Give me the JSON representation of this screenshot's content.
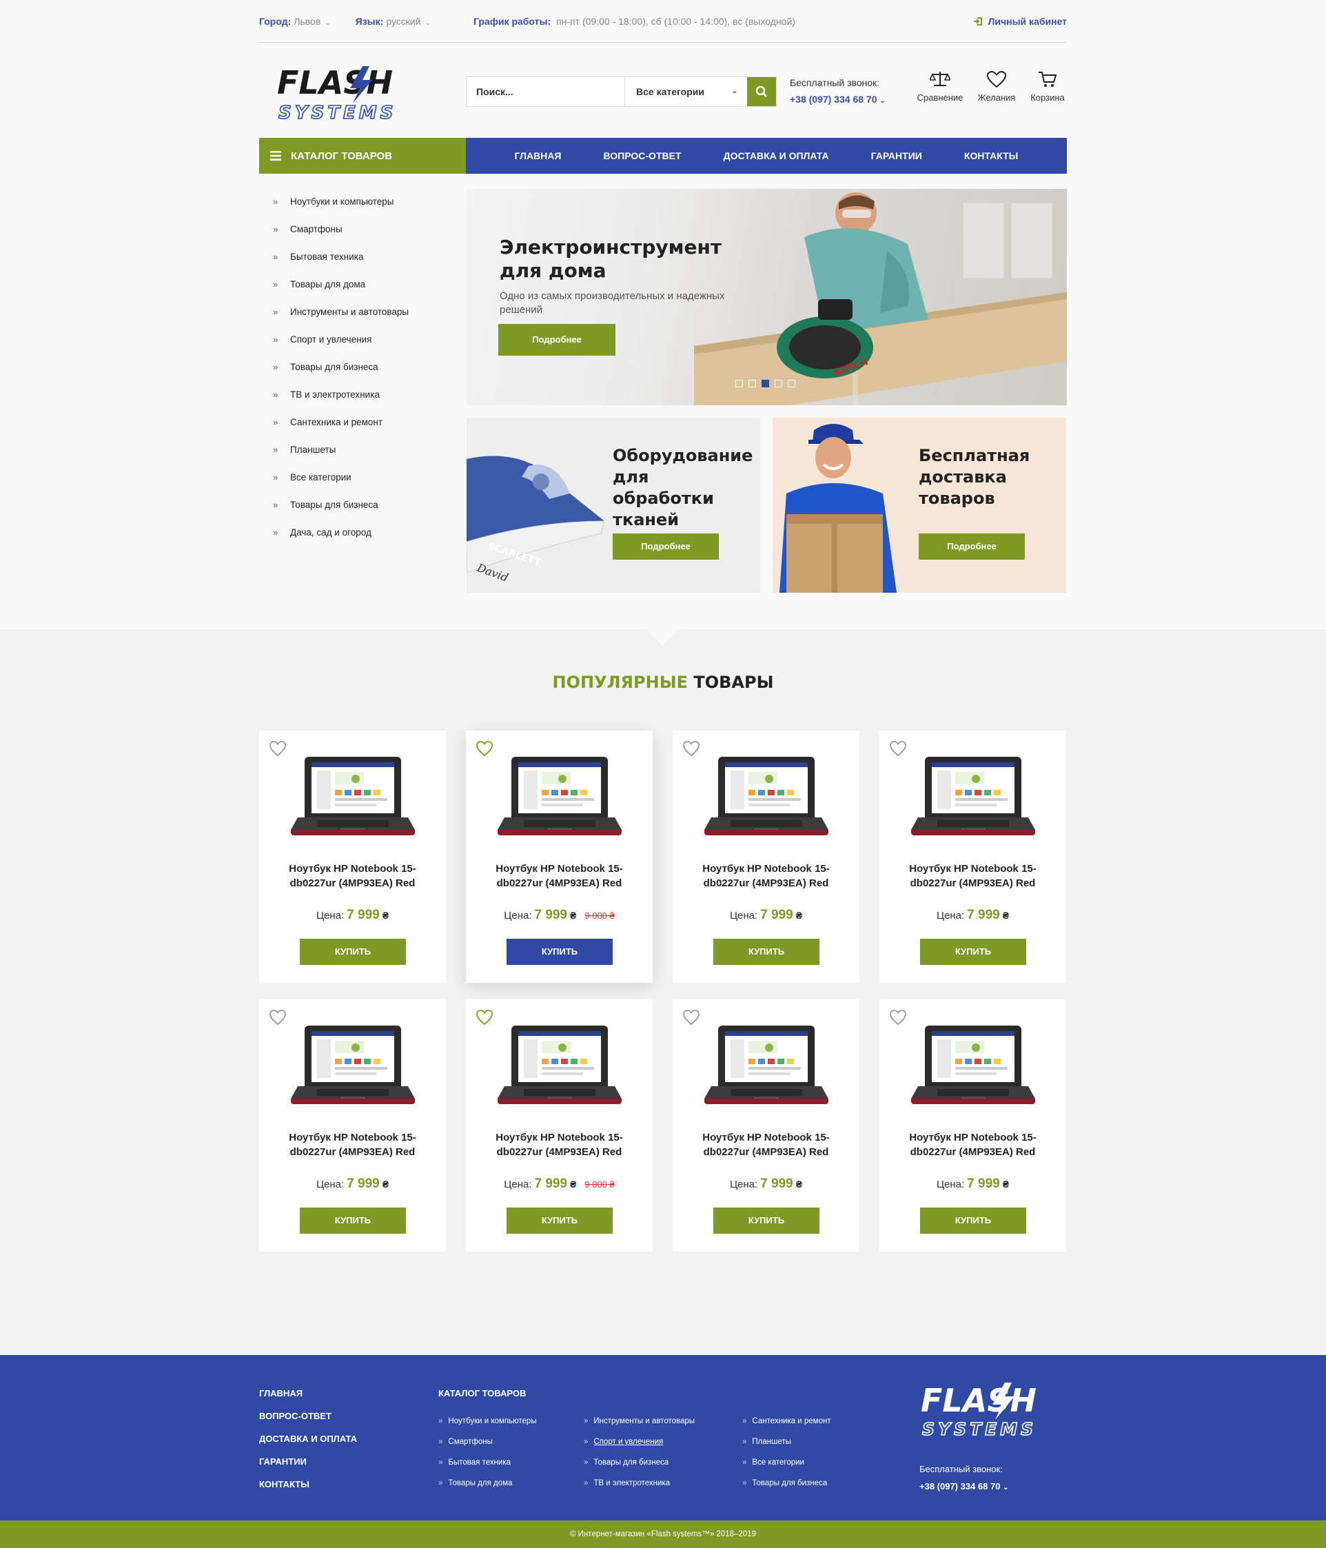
{
  "topbar": {
    "city_label": "Город:",
    "city_value": "Львов",
    "lang_label": "Язык:",
    "lang_value": "русский",
    "hours_label": "График работы:",
    "hours_value": "пн-пт (09:00 - 18:00), сб (10:00 - 14:00), вс (выходной)",
    "account": "Личный кабинет"
  },
  "header": {
    "logo_top": "FLASH",
    "logo_bottom": "SYSTEMS",
    "search_placeholder": "Поиск...",
    "category_select": "Все категории",
    "phone_label": "Бесплатный звонок:",
    "phone_number": "+38 (097) 334 68 70",
    "compare": "Сравнение",
    "wishlist": "Желания",
    "cart": "Корзина"
  },
  "nav": {
    "catalog": "КАТАЛОГ ТОВАРОВ",
    "items": [
      "ГЛАВНАЯ",
      "ВОПРОС-ОТВЕТ",
      "ДОСТАВКА И ОПЛАТА",
      "ГАРАНТИИ",
      "КОНТАКТЫ"
    ]
  },
  "sidebar": [
    "Ноутбуки и компьютеры",
    "Смартфоны",
    "Бытовая техника",
    "Товары для дома",
    "Инструменты и автотовары",
    "Спорт и увлечения",
    "Товары для бизнеса",
    "ТВ и электротехника",
    "Сантехника и ремонт",
    "Планшеты",
    "Все категории",
    "Товары для бизнеса",
    "Дача, сад и огород"
  ],
  "slider": {
    "title": "Электроинструмент для дома",
    "text": "Одно из самых производительных и надежных решений",
    "button": "Подробнее",
    "dots": 5,
    "active_dot": 3,
    "brand": "BOSCH"
  },
  "promos": [
    {
      "title": "Оборудование для обработки тканей",
      "button": "Подробнее",
      "brand": "SCARLETT",
      "model": "David"
    },
    {
      "title": "Бесплатная доставка товаров",
      "button": "Подробнее"
    }
  ],
  "popular": {
    "title_accent": "ПОПУЛЯРНЫЕ",
    "title_rest": "ТОВАРЫ",
    "products": [
      {
        "name": "Ноутбук HP Notebook 15-db0227ur (4MP93EA) Red",
        "price_label": "Цена:",
        "price": "7 999",
        "currency": "₴",
        "old_price": "",
        "buy": "КУПИТЬ",
        "favorite": false
      },
      {
        "name": "Ноутбук HP Notebook 15-db0227ur (4MP93EA) Red",
        "price_label": "Цена:",
        "price": "7 999",
        "currency": "₴",
        "old_price": "9 000 ₴",
        "buy": "КУПИТЬ",
        "favorite": true
      },
      {
        "name": "Ноутбук HP Notebook 15-db0227ur (4MP93EA) Red",
        "price_label": "Цена:",
        "price": "7 999",
        "currency": "₴",
        "old_price": "",
        "buy": "КУПИТЬ",
        "favorite": false
      },
      {
        "name": "Ноутбук HP Notebook 15-db0227ur (4MP93EA) Red",
        "price_label": "Цена:",
        "price": "7 999",
        "currency": "₴",
        "old_price": "",
        "buy": "КУПИТЬ",
        "favorite": false
      },
      {
        "name": "Ноутбук HP Notebook 15-db0227ur (4MP93EA) Red",
        "price_label": "Цена:",
        "price": "7 999",
        "currency": "₴",
        "old_price": "",
        "buy": "КУПИТЬ",
        "favorite": false
      },
      {
        "name": "Ноутбук HP Notebook 15-db0227ur (4MP93EA) Red",
        "price_label": "Цена:",
        "price": "7 999",
        "currency": "₴",
        "old_price": "9 000 ₴",
        "buy": "КУПИТЬ",
        "favorite": true
      },
      {
        "name": "Ноутбук HP Notebook 15-db0227ur (4MP93EA) Red",
        "price_label": "Цена:",
        "price": "7 999",
        "currency": "₴",
        "old_price": "",
        "buy": "КУПИТЬ",
        "favorite": false
      },
      {
        "name": "Ноутбук HP Notebook 15-db0227ur (4MP93EA) Red",
        "price_label": "Цена:",
        "price": "7 999",
        "currency": "₴",
        "old_price": "",
        "buy": "КУПИТЬ",
        "favorite": false
      }
    ]
  },
  "footer": {
    "menu": [
      "ГЛАВНАЯ",
      "ВОПРОС-ОТВЕТ",
      "ДОСТАВКА И ОПЛАТА",
      "ГАРАНТИИ",
      "КОНТАКТЫ"
    ],
    "catalog_title": "КАТАЛОГ ТОВАРОВ",
    "col_a": [
      "Ноутбуки и компьютеры",
      "Смартфоны",
      "Бытовая техника",
      "Товары для дома"
    ],
    "col_b": [
      "Инструменты и автотовары",
      "Спорт и увлечения",
      "Товары для бизнеса",
      "ТВ и электротехника"
    ],
    "col_c": [
      "Сантехника и ремонт",
      "Планшеты",
      "Все категории",
      "Товары для бизнеса"
    ],
    "phone_label": "Бесплатный звонок:",
    "phone_number": "+38 (097) 334 68 70",
    "copyright": "© Интернет-магазин «Flash systems™» 2018–2019"
  },
  "colors": {
    "green": "#7f9a24",
    "blue": "#3049a5",
    "old_price_red": "#dd3333"
  }
}
